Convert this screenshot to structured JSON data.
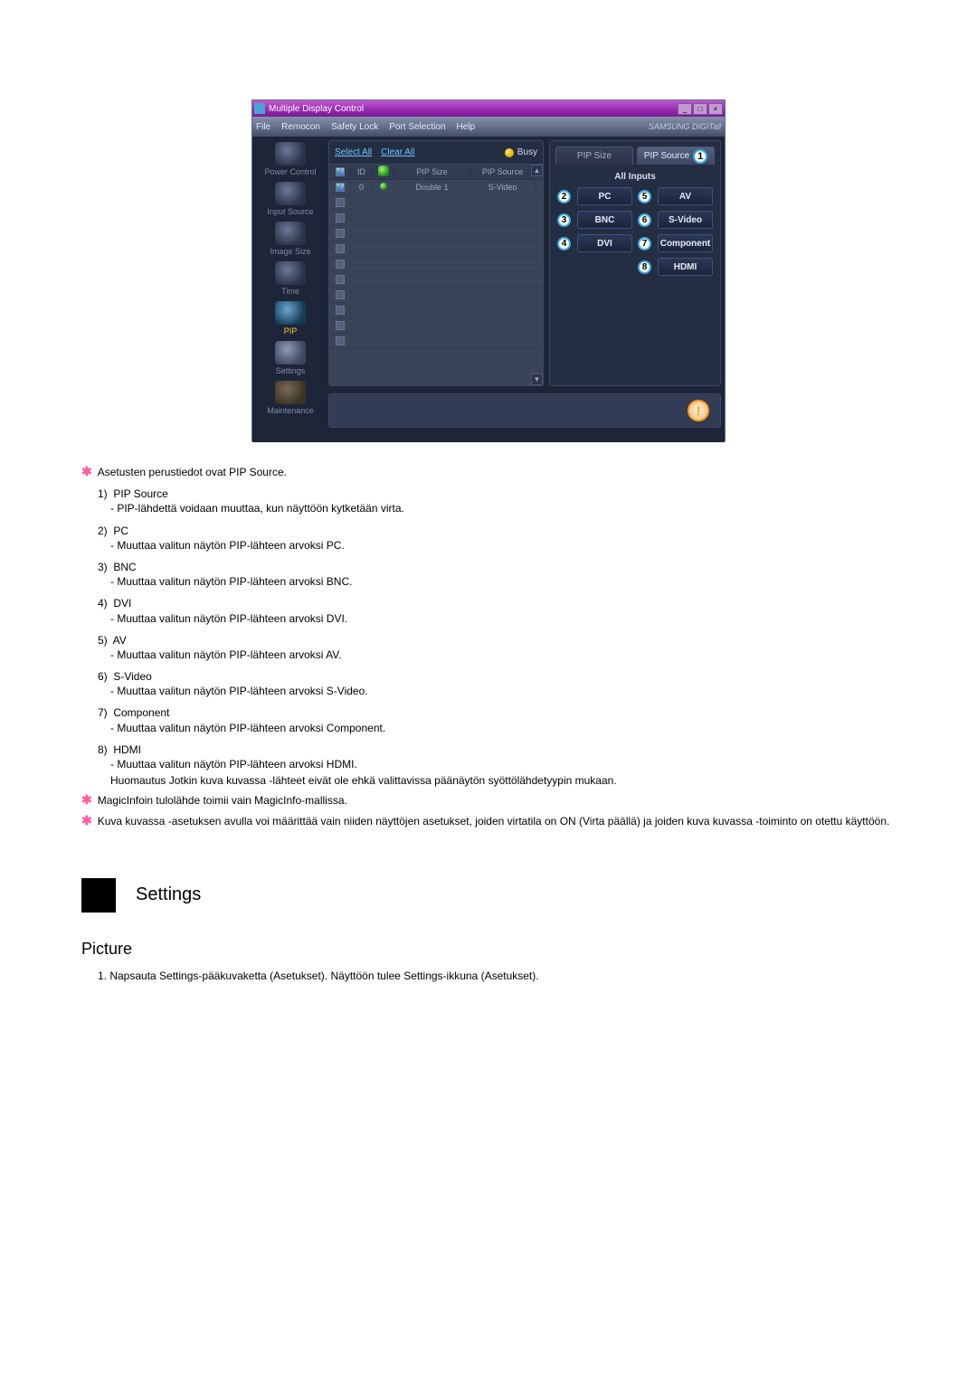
{
  "window": {
    "title": "Multiple Display Control",
    "minimize": "_",
    "maximize": "□",
    "close": "×"
  },
  "menubar": {
    "items": [
      "File",
      "Remocon",
      "Safety Lock",
      "Port Selection",
      "Help"
    ],
    "brand": "SAMSUNG DIGITall"
  },
  "sidebar": {
    "items": [
      {
        "label": "Power Control"
      },
      {
        "label": "Input Source"
      },
      {
        "label": "Image Size"
      },
      {
        "label": "Time"
      },
      {
        "label": "PIP",
        "active": true
      },
      {
        "label": "Settings"
      },
      {
        "label": "Maintenance"
      }
    ]
  },
  "leftpanel": {
    "select_all": "Select All",
    "clear_all": "Clear All",
    "busy_label": "Busy",
    "headers": {
      "checkbox": "☑",
      "id": "ID",
      "status": "",
      "size": "PIP Size",
      "source": "PIP Source"
    },
    "rows": [
      {
        "checked": true,
        "id": "0",
        "status": "green",
        "size": "Double 1",
        "source": "S-Video"
      },
      {
        "checked": false,
        "id": "",
        "status": "",
        "size": "",
        "source": ""
      },
      {
        "checked": false,
        "id": "",
        "status": "",
        "size": "",
        "source": ""
      },
      {
        "checked": false,
        "id": "",
        "status": "",
        "size": "",
        "source": ""
      },
      {
        "checked": false,
        "id": "",
        "status": "",
        "size": "",
        "source": ""
      },
      {
        "checked": false,
        "id": "",
        "status": "",
        "size": "",
        "source": ""
      },
      {
        "checked": false,
        "id": "",
        "status": "",
        "size": "",
        "source": ""
      },
      {
        "checked": false,
        "id": "",
        "status": "",
        "size": "",
        "source": ""
      },
      {
        "checked": false,
        "id": "",
        "status": "",
        "size": "",
        "source": ""
      },
      {
        "checked": false,
        "id": "",
        "status": "",
        "size": "",
        "source": ""
      },
      {
        "checked": false,
        "id": "",
        "status": "",
        "size": "",
        "source": ""
      }
    ],
    "scroll_up": "▲",
    "scroll_down": "▼"
  },
  "rightpanel": {
    "tab_size": "PIP Size",
    "tab_source": "PIP Source",
    "tab_source_num": "1",
    "subtitle": "All Inputs",
    "btns": [
      {
        "num": "2",
        "label": "PC"
      },
      {
        "num": "5",
        "label": "AV"
      },
      {
        "num": "3",
        "label": "BNC"
      },
      {
        "num": "6",
        "label": "S-Video"
      },
      {
        "num": "4",
        "label": "DVI"
      },
      {
        "num": "7",
        "label": "Component"
      },
      {
        "num": "8",
        "label": "HDMI"
      }
    ]
  },
  "doc": {
    "star1": "Asetusten perustiedot ovat PIP Source.",
    "items": [
      {
        "n": "1)",
        "t": "PIP Source",
        "d": "- PIP-lähdettä voidaan muuttaa, kun näyttöön kytketään virta."
      },
      {
        "n": "2)",
        "t": "PC",
        "d": "- Muuttaa valitun näytön PIP-lähteen arvoksi PC."
      },
      {
        "n": "3)",
        "t": "BNC",
        "d": "- Muuttaa valitun näytön PIP-lähteen arvoksi BNC."
      },
      {
        "n": "4)",
        "t": "DVI",
        "d": "- Muuttaa valitun näytön PIP-lähteen arvoksi DVI."
      },
      {
        "n": "5)",
        "t": "AV",
        "d": "- Muuttaa valitun näytön PIP-lähteen arvoksi AV."
      },
      {
        "n": "6)",
        "t": "S-Video",
        "d": "- Muuttaa valitun näytön PIP-lähteen arvoksi S-Video."
      },
      {
        "n": "7)",
        "t": "Component",
        "d": "- Muuttaa valitun näytön PIP-lähteen arvoksi Component."
      },
      {
        "n": "8)",
        "t": "HDMI",
        "d": "- Muuttaa valitun näytön PIP-lähteen arvoksi HDMI."
      }
    ],
    "note": "Huomautus Jotkin kuva kuvassa -lähteet eivät ole ehkä valittavissa päänäytön syöttölähdetyypin mukaan.",
    "star2": "MagicInfoin tulolähde toimii vain MagicInfo-mallissa.",
    "star3": "Kuva kuvassa -asetuksen avulla voi määrittää vain niiden näyttöjen asetukset, joiden virtatila on ON (Virta päällä) ja joiden kuva kuvassa -toiminto on otettu käyttöön.",
    "settings_heading": "Settings",
    "picture_heading": "Picture",
    "picture_1": "1.  Napsauta Settings-pääkuvaketta (Asetukset). Näyttöön tulee Settings-ikkuna (Asetukset)."
  }
}
